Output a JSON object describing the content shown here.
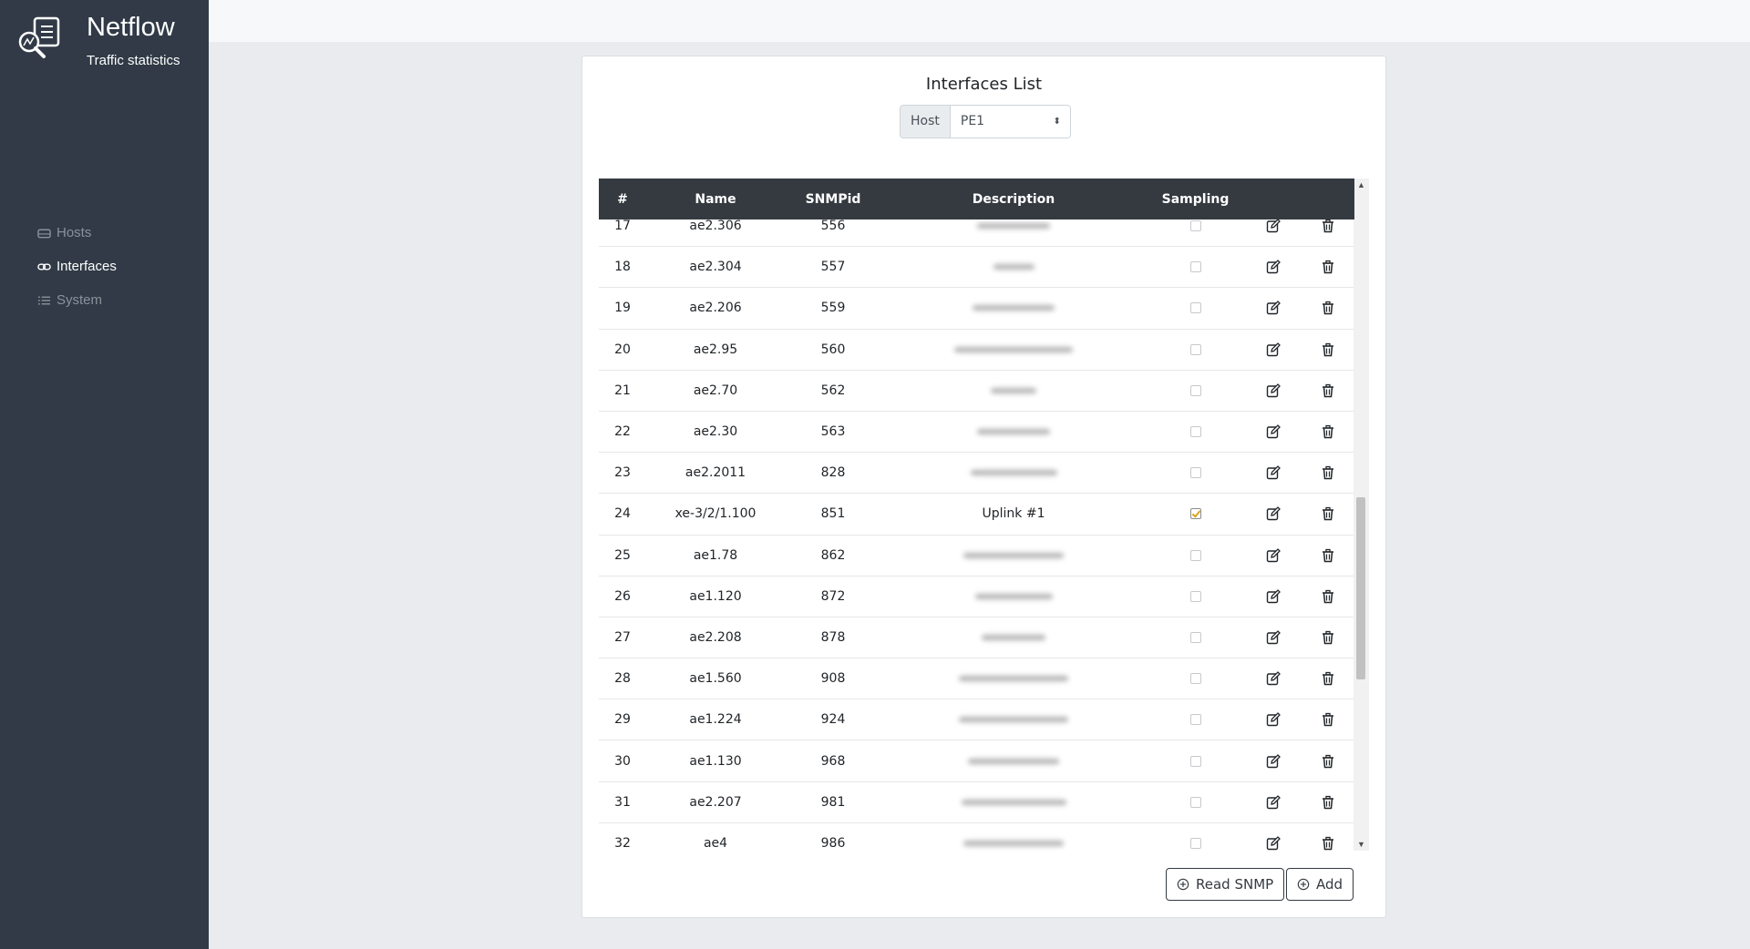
{
  "app": {
    "title": "Netflow",
    "subtitle": "Traffic statistics"
  },
  "sidebar": {
    "items": [
      {
        "label": "Hosts",
        "icon": "hdd-icon",
        "active": false
      },
      {
        "label": "Interfaces",
        "icon": "link-icon",
        "active": true
      },
      {
        "label": "System",
        "icon": "list-icon",
        "active": false
      }
    ]
  },
  "main": {
    "title": "Interfaces List",
    "host_label": "Host",
    "host_value": "PE1",
    "columns": [
      "#",
      "Name",
      "SNMPid",
      "Description",
      "Sampling"
    ],
    "rows": [
      {
        "num": "17",
        "name": "ae2.306",
        "snmp": "556",
        "desc": "",
        "sampling": false
      },
      {
        "num": "18",
        "name": "ae2.304",
        "snmp": "557",
        "desc": "",
        "sampling": false
      },
      {
        "num": "19",
        "name": "ae2.206",
        "snmp": "559",
        "desc": "",
        "sampling": false
      },
      {
        "num": "20",
        "name": "ae2.95",
        "snmp": "560",
        "desc": "",
        "sampling": false
      },
      {
        "num": "21",
        "name": "ae2.70",
        "snmp": "562",
        "desc": "",
        "sampling": false
      },
      {
        "num": "22",
        "name": "ae2.30",
        "snmp": "563",
        "desc": "",
        "sampling": false
      },
      {
        "num": "23",
        "name": "ae2.2011",
        "snmp": "828",
        "desc": "",
        "sampling": false
      },
      {
        "num": "24",
        "name": "xe-3/2/1.100",
        "snmp": "851",
        "desc": "Uplink #1",
        "sampling": true
      },
      {
        "num": "25",
        "name": "ae1.78",
        "snmp": "862",
        "desc": "",
        "sampling": false
      },
      {
        "num": "26",
        "name": "ae1.120",
        "snmp": "872",
        "desc": "",
        "sampling": false
      },
      {
        "num": "27",
        "name": "ae2.208",
        "snmp": "878",
        "desc": "",
        "sampling": false
      },
      {
        "num": "28",
        "name": "ae1.560",
        "snmp": "908",
        "desc": "",
        "sampling": false
      },
      {
        "num": "29",
        "name": "ae1.224",
        "snmp": "924",
        "desc": "",
        "sampling": false
      },
      {
        "num": "30",
        "name": "ae1.130",
        "snmp": "968",
        "desc": "",
        "sampling": false
      },
      {
        "num": "31",
        "name": "ae2.207",
        "snmp": "981",
        "desc": "",
        "sampling": false
      },
      {
        "num": "32",
        "name": "ae4",
        "snmp": "986",
        "desc": "",
        "sampling": false
      }
    ],
    "buttons": {
      "read_snmp": "Read SNMP",
      "add": "Add"
    }
  }
}
